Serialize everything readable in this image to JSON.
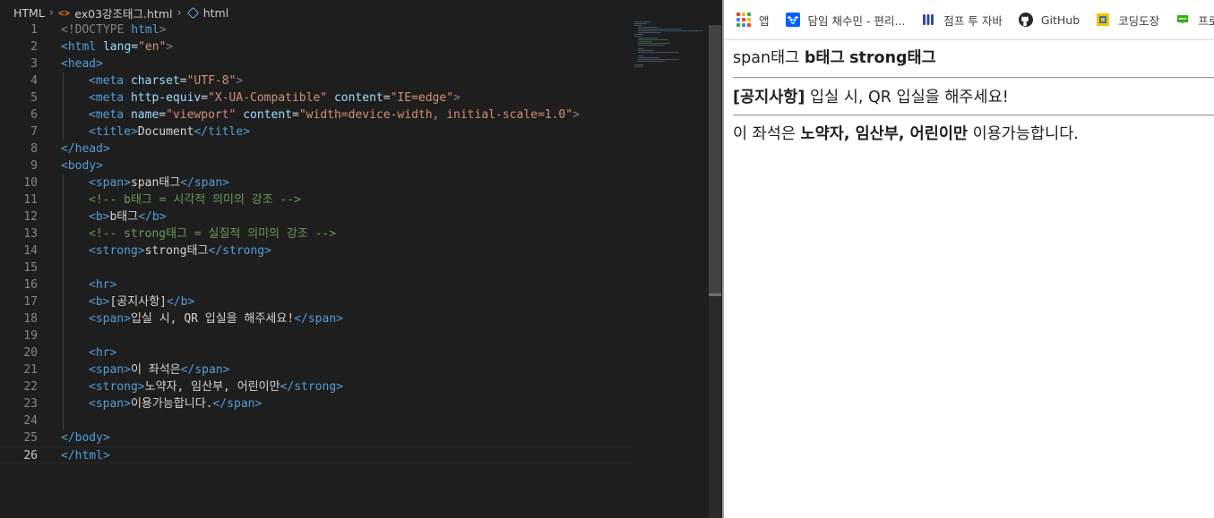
{
  "editor": {
    "breadcrumb": {
      "language": "HTML",
      "file": "ex03강조태그.html",
      "symbol": "html"
    },
    "line_numbers": [
      "1",
      "2",
      "3",
      "4",
      "5",
      "6",
      "7",
      "8",
      "9",
      "10",
      "11",
      "12",
      "13",
      "14",
      "15",
      "16",
      "17",
      "18",
      "19",
      "20",
      "21",
      "22",
      "23",
      "24",
      "25",
      "26"
    ],
    "active_line": "26",
    "code": {
      "l1_doctype": "<!DOCTYPE",
      "l1_html": " html",
      "l1_end": ">",
      "l2_open": "<html",
      "l2_attr": " lang",
      "l2_eq": "=",
      "l2_val": "\"en\"",
      "l2_end": ">",
      "l3": "<head>",
      "l4_open": "<meta",
      "l4_attr": " charset",
      "l4_val": "\"UTF-8\"",
      "l4_end": ">",
      "l5_open": "<meta",
      "l5_attr1": " http-equiv",
      "l5_val1": "\"X-UA-Compatible\"",
      "l5_attr2": " content",
      "l5_val2": "\"IE=edge\"",
      "l5_end": ">",
      "l6_open": "<meta",
      "l6_attr1": " name",
      "l6_val1": "\"viewport\"",
      "l6_attr2": " content",
      "l6_val2": "\"width=device-width, initial-scale=1.0\"",
      "l6_end": ">",
      "l7_open": "<title>",
      "l7_text": "Document",
      "l7_close": "</title>",
      "l8": "</head>",
      "l9": "<body>",
      "l10_open": "<span>",
      "l10_text": "span태그",
      "l10_close": "</span>",
      "l11": "<!-- b태그 = 시각적 의미의 강조 -->",
      "l12_open": "<b>",
      "l12_text": "b태그",
      "l12_close": "</b>",
      "l13": "<!-- strong태그 = 실질적 의미의 강조 -->",
      "l14_open": "<strong>",
      "l14_text": "strong태그",
      "l14_close": "</strong>",
      "l16": "<hr>",
      "l17_open": "<b>",
      "l17_text": "[공지사항]",
      "l17_close": "</b>",
      "l18_open": "<span>",
      "l18_text": "입실 시, QR 입실을 해주세요!",
      "l18_close": "</span>",
      "l20": "<hr>",
      "l21_open": "<span>",
      "l21_text": "이 좌석은",
      "l21_close": "</span>",
      "l22_open": "<strong>",
      "l22_text": "노약자, 임산부, 어린이만",
      "l22_close": "</strong>",
      "l23_open": "<span>",
      "l23_text": "이용가능합니다.",
      "l23_close": "</span>",
      "l25": "</body>",
      "l26": "</html>"
    }
  },
  "browser": {
    "bookmarks": [
      {
        "label": "앱",
        "icon": "apps-grid-icon"
      },
      {
        "label": "담임 채수민 - 편리...",
        "icon": "dropbox-icon"
      },
      {
        "label": "점프 투 자바",
        "icon": "wikidocs-icon"
      },
      {
        "label": "GitHub",
        "icon": "github-icon"
      },
      {
        "label": "코딩도장",
        "icon": "codingdojang-icon"
      },
      {
        "label": "프로그",
        "icon": "blog-icon"
      }
    ],
    "page": {
      "line1_span": "span태그",
      "line1_b": "b태그",
      "line1_strong": "strong태그",
      "line2_b": "[공지사항]",
      "line2_span": "입실 시, QR 입실을 해주세요!",
      "line3_span1": "이 좌석은",
      "line3_strong": "노약자, 임산부, 어린이만",
      "line3_span2": "이용가능합니다."
    }
  },
  "colors": {
    "editor_bg": "#1e1e1e",
    "tag": "#569cd6",
    "attr": "#9cdcfe",
    "string": "#ce9178",
    "comment": "#6a9955"
  }
}
